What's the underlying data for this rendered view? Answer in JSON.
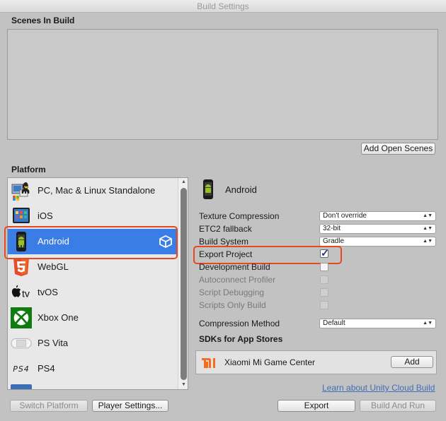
{
  "window": {
    "title": "Build Settings"
  },
  "scenes": {
    "title": "Scenes In Build",
    "add_open_scenes_label": "Add Open Scenes"
  },
  "platform": {
    "title": "Platform",
    "items": [
      {
        "label": "PC, Mac & Linux Standalone",
        "icon": "standalone-icon"
      },
      {
        "label": "iOS",
        "icon": "ios-icon"
      },
      {
        "label": "Android",
        "icon": "android-icon",
        "selected": true
      },
      {
        "label": "WebGL",
        "icon": "html5-icon"
      },
      {
        "label": "tvOS",
        "icon": "apple-tv-icon"
      },
      {
        "label": "Xbox One",
        "icon": "xbox-icon"
      },
      {
        "label": "PS Vita",
        "icon": "ps-vita-icon"
      },
      {
        "label": "PS4",
        "icon": "ps4-icon"
      }
    ],
    "ps4_logo_text": "PS4"
  },
  "settings": {
    "platform_name": "Android",
    "texture_compression": {
      "label": "Texture Compression",
      "value": "Don't override"
    },
    "etc2_fallback": {
      "label": "ETC2 fallback",
      "value": "32-bit"
    },
    "build_system": {
      "label": "Build System",
      "value": "Gradle"
    },
    "export_project": {
      "label": "Export Project",
      "checked": true
    },
    "development_build": {
      "label": "Development Build",
      "checked": false
    },
    "autoconnect_profiler": {
      "label": "Autoconnect Profiler",
      "enabled": false
    },
    "script_debugging": {
      "label": "Script Debugging",
      "enabled": false
    },
    "scripts_only_build": {
      "label": "Scripts Only Build",
      "enabled": false
    },
    "compression_method": {
      "label": "Compression Method",
      "value": "Default"
    },
    "sdks_title": "SDKs for App Stores",
    "sdk": {
      "name": "Xiaomi Mi Game Center",
      "add_label": "Add"
    }
  },
  "footer": {
    "cloud_build_link": "Learn about Unity Cloud Build",
    "switch_platform_label": "Switch Platform",
    "player_settings_label": "Player Settings...",
    "export_label": "Export",
    "build_and_run_label": "Build And Run"
  },
  "colors": {
    "selection": "#3a7de6",
    "highlight": "#e8481f",
    "link": "#3f6fb8"
  }
}
